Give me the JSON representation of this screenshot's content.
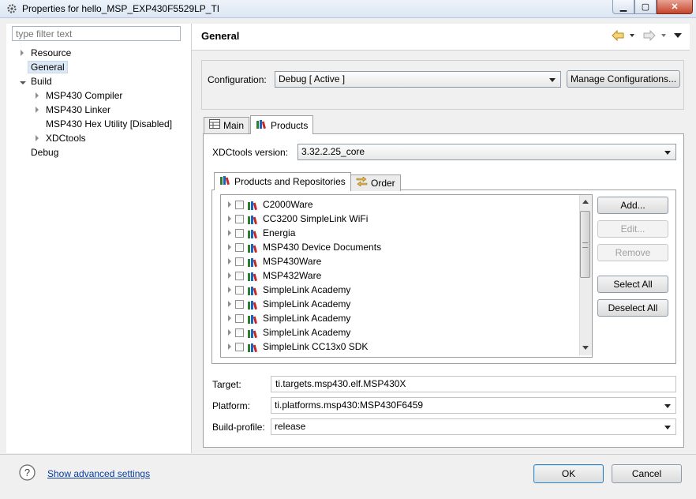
{
  "window": {
    "title": "Properties for hello_MSP_EXP430F5529LP_TI"
  },
  "filter": {
    "placeholder": "type filter text"
  },
  "tree": {
    "resource": "Resource",
    "general": "General",
    "build": "Build",
    "compiler": "MSP430 Compiler",
    "linker": "MSP430 Linker",
    "hex": "MSP430 Hex Utility  [Disabled]",
    "xdctools": "XDCtools",
    "debug": "Debug"
  },
  "header": {
    "title": "General"
  },
  "config": {
    "label": "Configuration:",
    "value": "Debug  [ Active ]",
    "manage": "Manage Configurations..."
  },
  "tabs": {
    "main": "Main",
    "products": "Products"
  },
  "products": {
    "version_label": "XDCtools version:",
    "version_value": "3.32.2.25_core",
    "subtab_products": "Products and Repositories",
    "subtab_order": "Order",
    "items": [
      "C2000Ware",
      "CC3200 SimpleLink WiFi",
      "Energia",
      "MSP430 Device Documents",
      "MSP430Ware",
      "MSP432Ware",
      "SimpleLink Academy",
      "SimpleLink Academy",
      "SimpleLink Academy",
      "SimpleLink Academy",
      "SimpleLink CC13x0 SDK"
    ],
    "buttons": {
      "add": "Add...",
      "edit": "Edit...",
      "remove": "Remove",
      "select_all": "Select All",
      "deselect_all": "Deselect All"
    },
    "target_label": "Target:",
    "target_value": "ti.targets.msp430.elf.MSP430X",
    "platform_label": "Platform:",
    "platform_value": "ti.platforms.msp430:MSP430F6459",
    "profile_label": "Build-profile:",
    "profile_value": "release"
  },
  "footer": {
    "advanced": "Show advanced settings",
    "ok": "OK",
    "cancel": "Cancel"
  }
}
